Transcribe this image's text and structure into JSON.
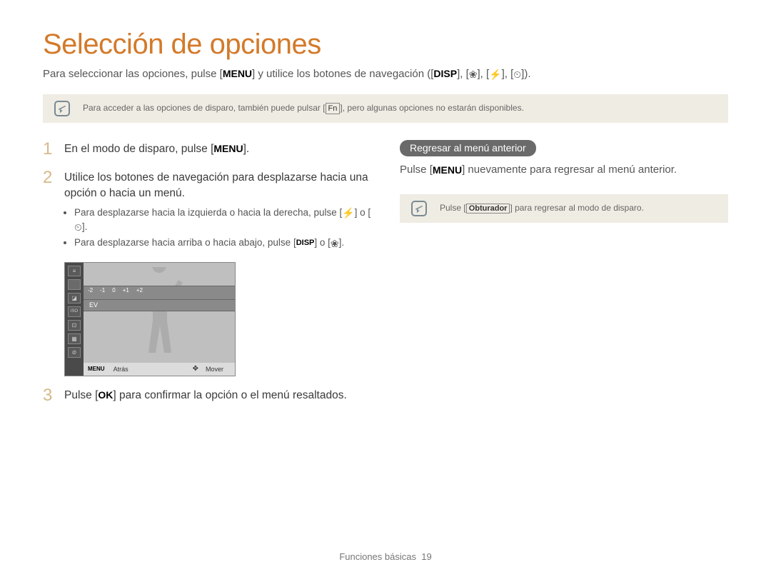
{
  "title": "Selección de opciones",
  "subtitle": {
    "p1": "Para seleccionar las opciones, pulse [",
    "menu": "MENU",
    "p2": "] y utilice los botones de navegación ([",
    "disp": "DISP",
    "p3": "], [",
    "p4": "], [",
    "p5": "], [",
    "p6": "])."
  },
  "note1": {
    "p1": "Para acceder a las opciones de disparo, también puede pulsar [",
    "fn": "Fn",
    "p2": "], pero algunas opciones no estarán disponibles."
  },
  "steps": {
    "s1": {
      "num": "1",
      "t1": "En el modo de disparo, pulse [",
      "menu": "MENU",
      "t2": "]."
    },
    "s2": {
      "num": "2",
      "text": "Utilice los botones de navegación para desplazarse hacia una opción o hacia un menú.",
      "b1": {
        "a": "Para desplazarse hacia la izquierda o hacia la derecha, pulse [",
        "b": "] o [",
        "c": "]."
      },
      "b2": {
        "a": "Para desplazarse hacia arriba o hacia abajo, pulse [",
        "disp": "DISP",
        "b": "] o [",
        "c": "]."
      }
    },
    "s3": {
      "num": "3",
      "t1": "Pulse [",
      "ok": "OK",
      "t2": "] para confirmar la opción o el menú resaltados."
    }
  },
  "screenshot": {
    "ev_marks": [
      "-2",
      "-1",
      "0",
      "+1",
      "+2"
    ],
    "ev_label": "EV",
    "footer_menu": "MENU",
    "footer_back": "Atrás",
    "footer_move": "Mover"
  },
  "right": {
    "pill": "Regresar al menú anterior",
    "line": {
      "a": "Pulse [",
      "menu": "MENU",
      "b": "] nuevamente para regresar al menú anterior."
    },
    "note": {
      "a": "Pulse [",
      "obt": "Obturador",
      "b": "] para regresar al modo de disparo."
    }
  },
  "footer": {
    "section": "Funciones básicas",
    "page": "19"
  },
  "icons": {
    "macro": "❀",
    "flash": "⚡",
    "timer": "⏲",
    "nav": "✥",
    "ev": "◪"
  }
}
